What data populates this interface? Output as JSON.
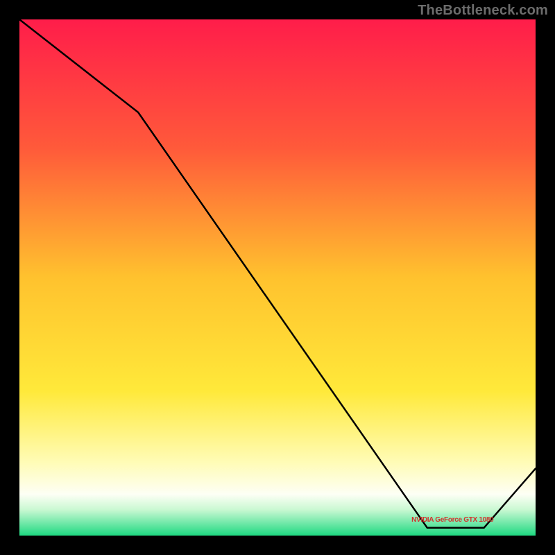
{
  "watermark": "TheBottleneck.com",
  "annotation_label": "NVIDIA GeForce GTX 1080",
  "chart_data": {
    "type": "line",
    "title": "",
    "xlabel": "",
    "ylabel": "",
    "xlim": [
      0,
      100
    ],
    "ylim": [
      0,
      100
    ],
    "x": [
      0,
      23,
      79,
      90,
      100
    ],
    "values": [
      100,
      82,
      1.5,
      1.5,
      13
    ],
    "annotations": [
      {
        "text": "NVIDIA GeForce GTX 1080",
        "x": 82,
        "y": 3
      }
    ],
    "gradient_stops": [
      {
        "pct": 0,
        "color": "#ff1d4a"
      },
      {
        "pct": 25,
        "color": "#ff5a3a"
      },
      {
        "pct": 50,
        "color": "#ffc22e"
      },
      {
        "pct": 72,
        "color": "#ffe93a"
      },
      {
        "pct": 86,
        "color": "#fffcb8"
      },
      {
        "pct": 92,
        "color": "#fdfff5"
      },
      {
        "pct": 95,
        "color": "#c9f8d2"
      },
      {
        "pct": 100,
        "color": "#1ed981"
      }
    ]
  }
}
